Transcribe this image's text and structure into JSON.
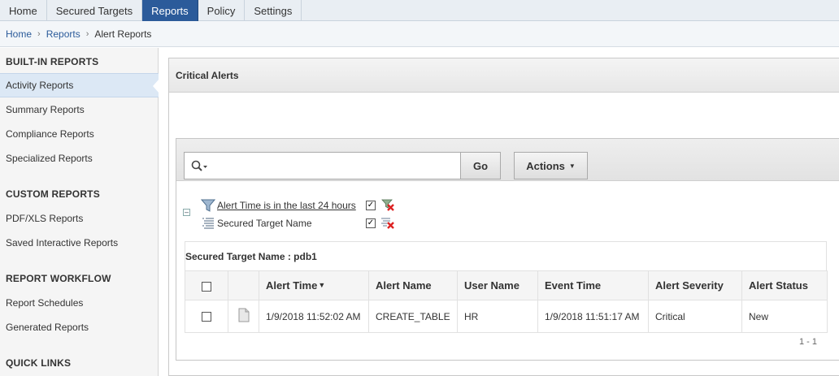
{
  "nav": {
    "tabs": [
      {
        "label": "Home"
      },
      {
        "label": "Secured Targets"
      },
      {
        "label": "Reports"
      },
      {
        "label": "Policy"
      },
      {
        "label": "Settings"
      }
    ],
    "active_tab": "Reports",
    "active_color": "#2b5b9a"
  },
  "breadcrumb": {
    "items": [
      "Home",
      "Reports"
    ],
    "current": "Alert Reports"
  },
  "sidebar": {
    "sections": [
      {
        "heading": "BUILT-IN REPORTS",
        "items": [
          "Activity Reports",
          "Summary Reports",
          "Compliance Reports",
          "Specialized Reports"
        ]
      },
      {
        "heading": "CUSTOM REPORTS",
        "items": [
          "PDF/XLS Reports",
          "Saved Interactive Reports"
        ]
      },
      {
        "heading": "REPORT WORKFLOW",
        "items": [
          "Report Schedules",
          "Generated Reports"
        ]
      },
      {
        "heading": "QUICK LINKS",
        "items": []
      }
    ],
    "selected_item": "Activity Reports"
  },
  "region": {
    "title": "Critical Alerts"
  },
  "toolbar": {
    "search_value": "",
    "search_icon": "search-icon",
    "go_label": "Go",
    "actions_label": "Actions"
  },
  "filters": [
    {
      "label": "Alert Time is in the last 24 hours",
      "type": "filter",
      "enabled": true
    },
    {
      "label": "Secured Target Name",
      "type": "control-break",
      "enabled": true
    }
  ],
  "group_break": {
    "label": "Secured Target Name : pdb1"
  },
  "table": {
    "columns": [
      "",
      "",
      "Alert Time",
      "Alert Name",
      "User Name",
      "Event Time",
      "Alert Severity",
      "Alert Status"
    ],
    "sorted_column": "Alert Time",
    "sort_direction": "descending",
    "rows": [
      {
        "checked": false,
        "icon": "document-icon",
        "alert_time": "1/9/2018 11:52:02 AM",
        "alert_name": "CREATE_TABLE",
        "user_name": "HR",
        "event_time": "1/9/2018 11:51:17 AM",
        "alert_severity": "Critical",
        "alert_status": "New"
      }
    ]
  },
  "pagination": "1 - 1"
}
